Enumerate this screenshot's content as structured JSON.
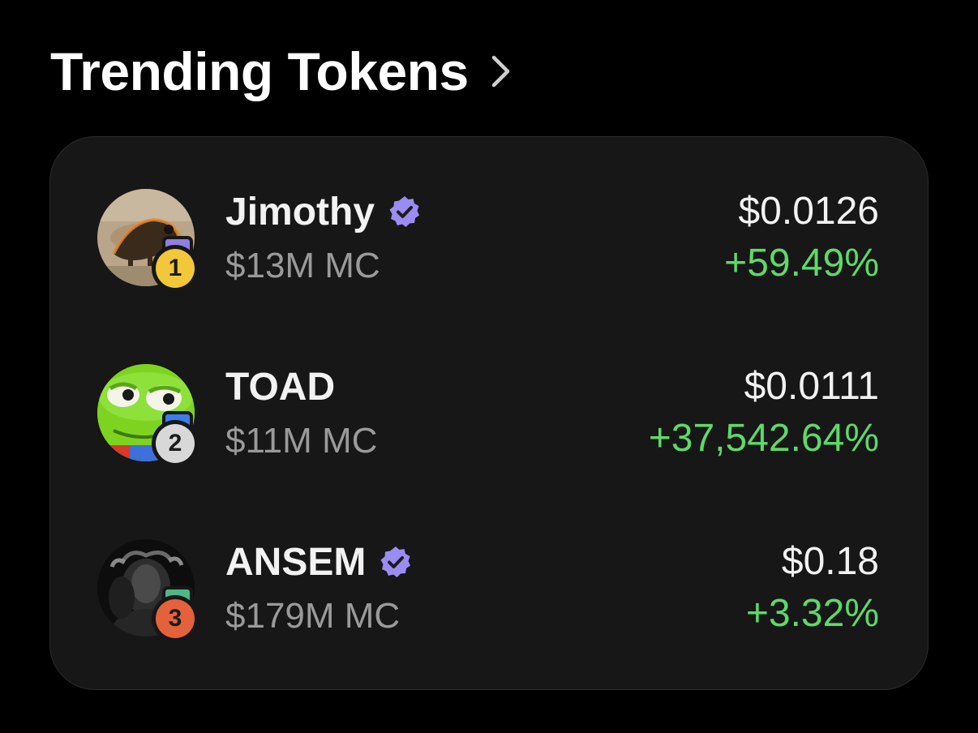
{
  "header": {
    "title": "Trending Tokens",
    "chevron_icon": "chevron-right-icon"
  },
  "colors": {
    "background": "#000000",
    "card": "#171717",
    "positive_change": "#5ed96a",
    "secondary_text": "#9a9a9a",
    "verified_badge": "#9b8cf2",
    "medal_gold": "#f2c73a",
    "medal_silver": "#d8d8d8",
    "medal_bronze": "#e3623c"
  },
  "tokens": [
    {
      "rank": "1",
      "name": "Jimothy",
      "verified": true,
      "market_cap": "$13M MC",
      "price": "$0.0126",
      "change": "+59.49%",
      "medal_color": "#f2c73a",
      "ribbon_color": "#8f7fe0"
    },
    {
      "rank": "2",
      "name": "TOAD",
      "verified": false,
      "market_cap": "$11M MC",
      "price": "$0.0111",
      "change": "+37,542.64%",
      "medal_color": "#d8d8d8",
      "ribbon_color": "#3a7ee8"
    },
    {
      "rank": "3",
      "name": "ANSEM",
      "verified": true,
      "market_cap": "$179M MC",
      "price": "$0.18",
      "change": "+3.32%",
      "medal_color": "#e3623c",
      "ribbon_color": "#4cb887"
    }
  ]
}
